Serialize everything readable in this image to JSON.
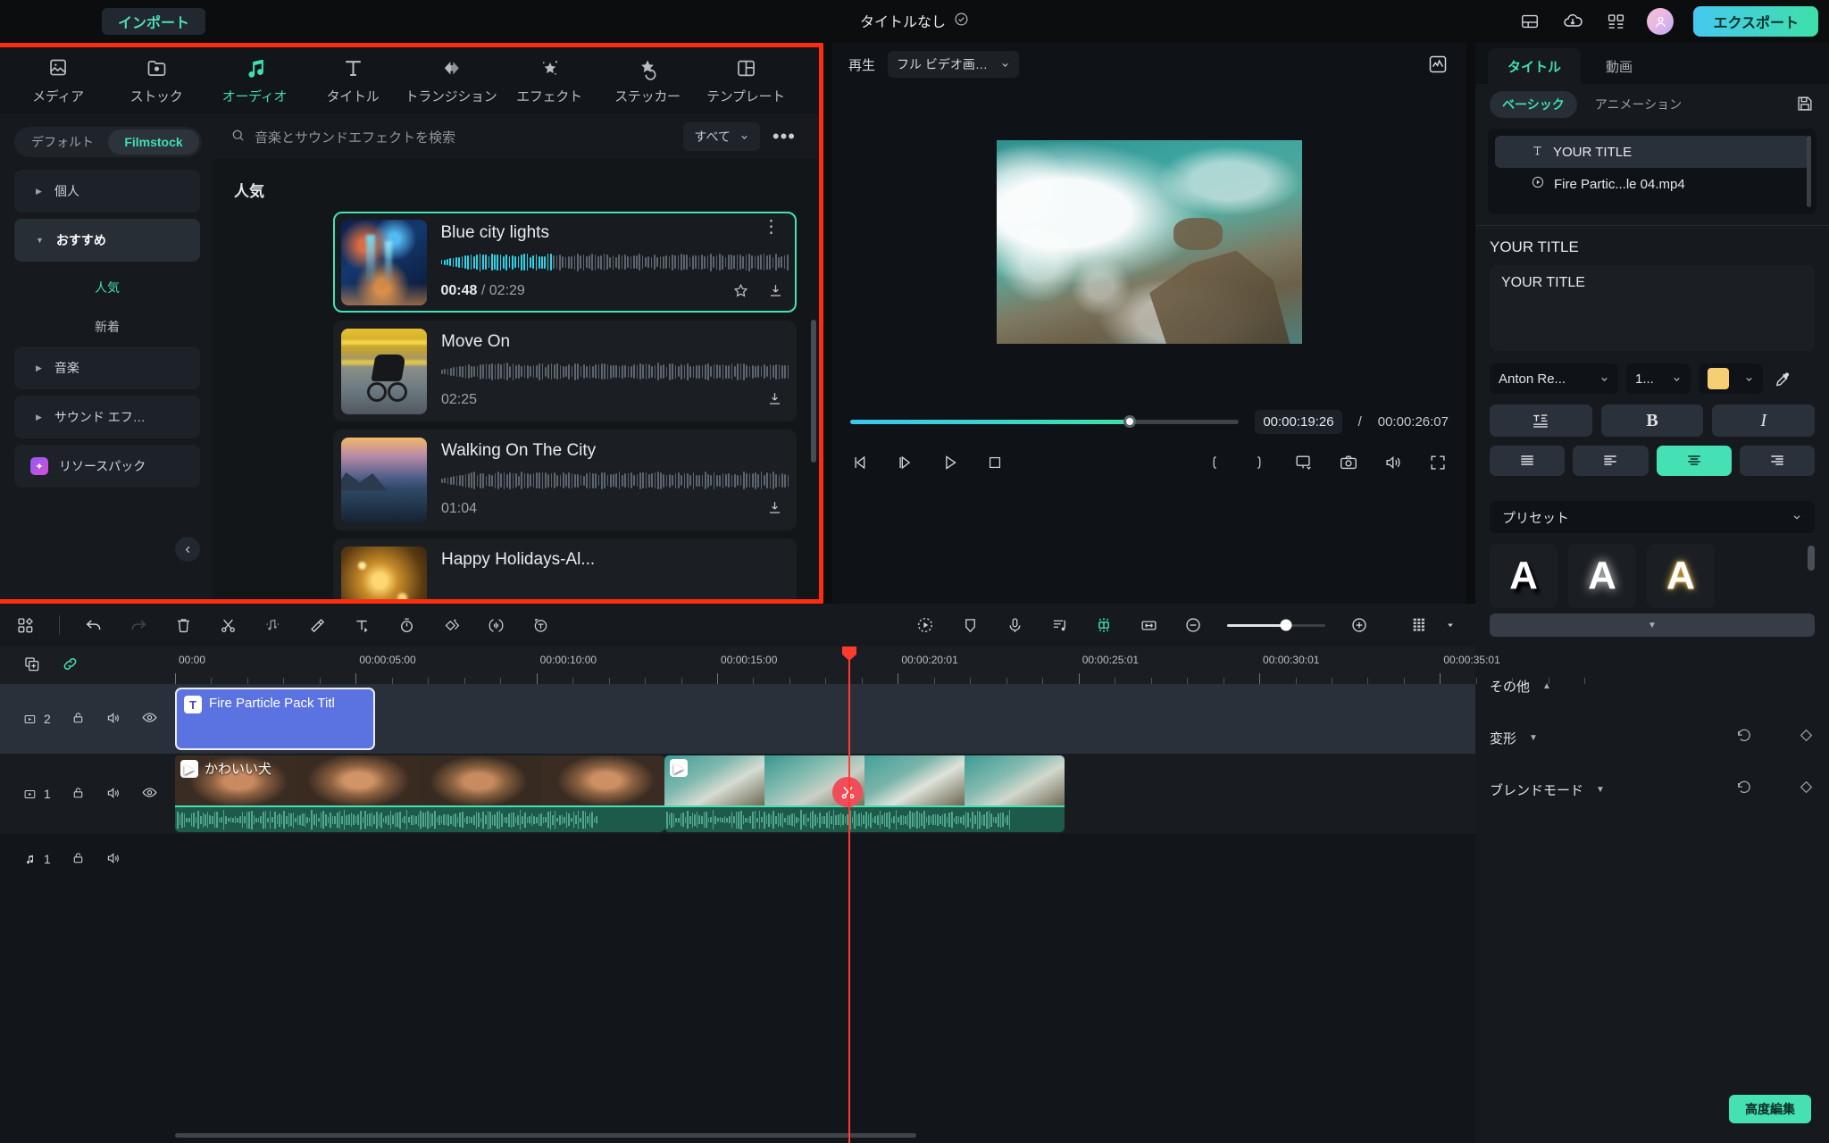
{
  "topbar": {
    "import_label": "インポート",
    "project_title": "タイトルなし",
    "export_label": "エクスポート",
    "icons": [
      "layout-icon",
      "cloud-upload-icon",
      "grid-menu-icon",
      "avatar"
    ]
  },
  "leftpanel": {
    "nav_tabs": [
      {
        "label": "メディア",
        "icon": "media-icon",
        "active": false
      },
      {
        "label": "ストック",
        "icon": "stock-folder-icon",
        "active": false
      },
      {
        "label": "オーディオ",
        "icon": "audio-note-icon",
        "active": true
      },
      {
        "label": "タイトル",
        "icon": "title-t-icon",
        "active": false
      },
      {
        "label": "トランジション",
        "icon": "transition-icon",
        "active": false
      },
      {
        "label": "エフェクト",
        "icon": "effect-sparkle-icon",
        "active": false
      },
      {
        "label": "ステッカー",
        "icon": "sticker-icon",
        "active": false
      },
      {
        "label": "テンプレート",
        "icon": "template-icon",
        "active": false
      }
    ],
    "segment": {
      "left": "デフォルト",
      "right": "Filmstock",
      "selected": "Filmstock"
    },
    "categories": [
      {
        "label": "個人",
        "expanded": false,
        "type": "group"
      },
      {
        "label": "おすすめ",
        "expanded": true,
        "type": "group"
      },
      {
        "label": "人気",
        "type": "sub",
        "selected": true
      },
      {
        "label": "新着",
        "type": "sub",
        "selected": false
      },
      {
        "label": "音楽",
        "expanded": false,
        "type": "group"
      },
      {
        "label": "サウンド エフ…",
        "expanded": false,
        "type": "group"
      }
    ],
    "resource_pack": "リソースパック",
    "search_placeholder": "音楽とサウンドエフェクトを検索",
    "filter_label": "すべて",
    "section_title": "人気",
    "tracks": [
      {
        "title": "Blue city lights",
        "current": "00:48",
        "total": "02:29",
        "selected": true,
        "progress": 32
      },
      {
        "title": "Move On",
        "current": "",
        "total": "02:25",
        "selected": false,
        "progress": 0
      },
      {
        "title": "Walking On The City",
        "current": "",
        "total": "01:04",
        "selected": false,
        "progress": 0
      },
      {
        "title": "Happy Holidays-Al...",
        "current": "",
        "total": "",
        "selected": false,
        "progress": 0
      }
    ]
  },
  "player": {
    "play_label": "再生",
    "quality_option": "フル ビデオ画…",
    "current_time": "00:00:19:26",
    "total_time": "00:00:26:07",
    "progress_percent": 72,
    "controls": [
      "prev-frame-icon",
      "next-frame-icon",
      "play-icon",
      "stop-icon",
      "mark-in-icon",
      "mark-out-icon",
      "display-mode-icon",
      "snapshot-icon",
      "volume-icon",
      "fullscreen-icon"
    ]
  },
  "right": {
    "tabs": [
      {
        "label": "タイトル",
        "active": true
      },
      {
        "label": "動画",
        "active": false
      }
    ],
    "pills": [
      {
        "label": "ベーシック",
        "active": true
      },
      {
        "label": "アニメーション",
        "active": false
      }
    ],
    "save_icon": "save-disk-icon",
    "layers": [
      {
        "label": "YOUR TITLE",
        "icon": "text-t-icon",
        "selected": true
      },
      {
        "label": "Fire Partic...le 04.mp4",
        "icon": "play-circle-icon",
        "selected": false
      }
    ],
    "section_title": "YOUR TITLE",
    "text_value": "YOUR TITLE",
    "font_family": "Anton Re...",
    "font_size": "1...",
    "font_color": "#f5cf72",
    "eyedropper": "eyedropper-icon",
    "style_buttons": [
      {
        "name": "text-style-icon",
        "label": ""
      },
      {
        "name": "bold-button",
        "label": "B"
      },
      {
        "name": "italic-button",
        "label": "I"
      }
    ],
    "align_buttons": [
      {
        "name": "align-justify-button",
        "active": false
      },
      {
        "name": "align-left-button",
        "active": false
      },
      {
        "name": "align-center-button",
        "active": true
      },
      {
        "name": "align-right-button",
        "active": false
      }
    ],
    "preset_label": "プリセット",
    "presets": [
      {
        "glyph": "A",
        "style": "shadow"
      },
      {
        "glyph": "A",
        "style": "glow"
      },
      {
        "glyph": "A",
        "style": "gold"
      }
    ],
    "sections": [
      {
        "label": "その他",
        "arrow": "▲",
        "has_actions": false
      },
      {
        "label": "変形",
        "arrow": "▼",
        "has_actions": true
      },
      {
        "label": "ブレンドモード",
        "arrow": "▼",
        "has_actions": true
      }
    ],
    "advanced_label": "高度編集"
  },
  "timeline": {
    "toolbar_left": [
      "layout-grid-icon",
      "undo-icon",
      "redo-icon",
      "delete-icon",
      "split-scissors-icon",
      "audio-detach-icon",
      "crop-icon",
      "text-add-icon",
      "speed-icon",
      "keyframe-icon",
      "audio-mix-icon",
      "auto-caption-icon"
    ],
    "toolbar_right": [
      "motion-tracking-icon",
      "mask-icon",
      "voiceover-icon",
      "beat-detect-icon",
      "green-screen-icon",
      "fit-width-icon",
      "zoom-out-icon",
      "zoom-slider",
      "zoom-in-icon",
      "track-view-icon"
    ],
    "zoom_percent": 60,
    "ruler_ticks": [
      "00:00",
      "00:00:05:00",
      "00:00:10:00",
      "00:00:15:00",
      "00:00:20:01",
      "00:00:25:01",
      "00:00:30:01",
      "00:00:35:01"
    ],
    "playhead_time": "00:00:20:01",
    "tracks": [
      {
        "index": "2",
        "type": "video",
        "icons": [
          "lock-icon",
          "mute-icon",
          "eye-icon"
        ]
      },
      {
        "index": "1",
        "type": "video",
        "icons": [
          "lock-icon",
          "mute-icon",
          "eye-icon"
        ]
      },
      {
        "index": "1",
        "type": "audio",
        "icons": [
          "lock-icon",
          "mute-icon"
        ]
      }
    ],
    "clips": [
      {
        "track": "2",
        "name": "Fire Particle Pack Titl",
        "kind": "title"
      },
      {
        "track": "1",
        "name": "かわいい犬",
        "kind": "video"
      },
      {
        "track": "1",
        "name": "",
        "kind": "video2"
      }
    ]
  }
}
